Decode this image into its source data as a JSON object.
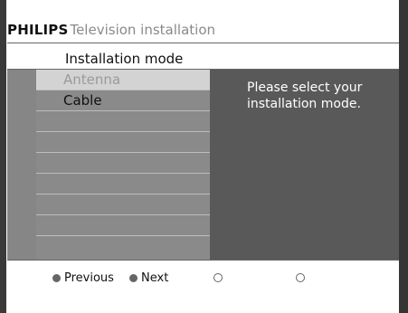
{
  "header": {
    "brand": "PHILIPS",
    "title": "Television installation"
  },
  "section": {
    "title": "Installation mode"
  },
  "options": [
    {
      "label": "Antenna"
    },
    {
      "label": "Cable"
    },
    {
      "label": ""
    },
    {
      "label": ""
    },
    {
      "label": ""
    },
    {
      "label": ""
    },
    {
      "label": ""
    },
    {
      "label": ""
    }
  ],
  "panel": {
    "message": "Please select your installation mode."
  },
  "footer": {
    "previous_label": "Previous",
    "next_label": "Next"
  }
}
